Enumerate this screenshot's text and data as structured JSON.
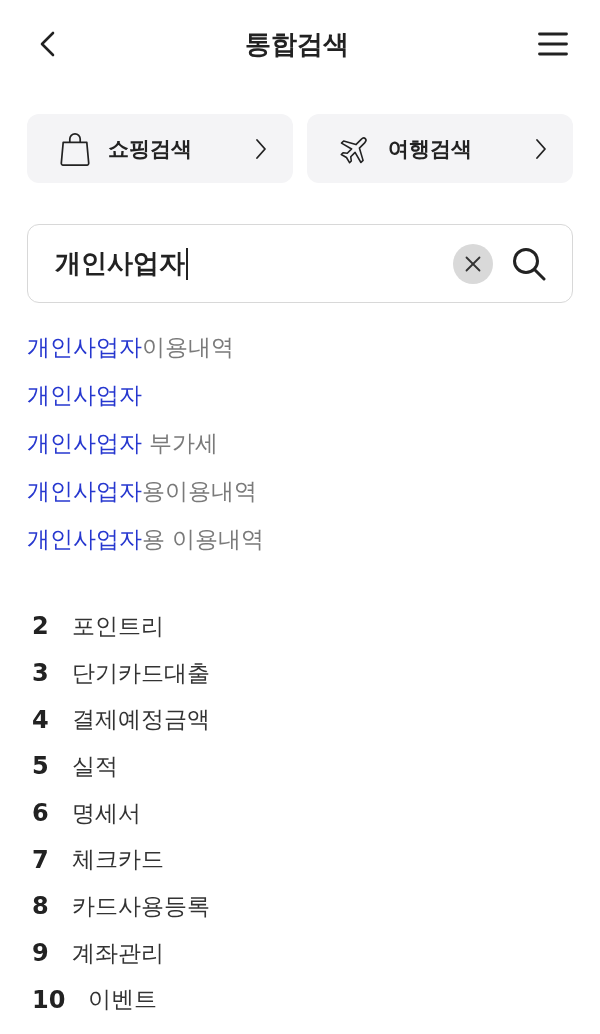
{
  "header": {
    "title": "통합검색"
  },
  "shortcuts": [
    {
      "kind": "shopping",
      "label": "쇼핑검색"
    },
    {
      "kind": "travel",
      "label": "여행검색"
    }
  ],
  "search": {
    "value": "개인사업자",
    "focused": true
  },
  "suggestions": [
    {
      "match": "개인사업자",
      "rest": "이용내역"
    },
    {
      "match": "개인사업자"
    },
    {
      "match": "개인사업자",
      "rest": " 부가세"
    },
    {
      "match": "개인사업자",
      "rest": "용이용내역"
    },
    {
      "match": "개인사업자",
      "rest": "용 이용내역"
    }
  ],
  "popular": [
    {
      "rank": "2",
      "term": "포인트리"
    },
    {
      "rank": "3",
      "term": "단기카드대출"
    },
    {
      "rank": "4",
      "term": "결제예정금액"
    },
    {
      "rank": "5",
      "term": "실적"
    },
    {
      "rank": "6",
      "term": "명세서"
    },
    {
      "rank": "7",
      "term": "체크카드"
    },
    {
      "rank": "8",
      "term": "카드사용등록"
    },
    {
      "rank": "9",
      "term": "계좌관리"
    },
    {
      "rank": "10",
      "term": "이벤트"
    }
  ]
}
